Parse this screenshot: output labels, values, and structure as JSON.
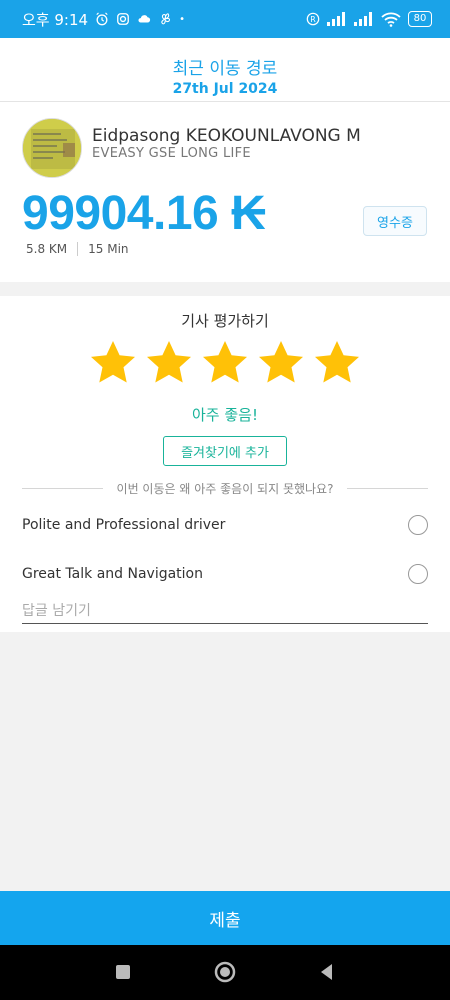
{
  "status": {
    "time": "오후 9:14",
    "battery": "80"
  },
  "header": {
    "title": "최근 이동 경로",
    "date": "27th Jul 2024"
  },
  "trip": {
    "driver_name": "Eidpasong KEOKOUNLAVONG M",
    "company": "EVEASY GSE LONG LIFE",
    "fare": "99904.16 ₭",
    "receipt_label": "영수증",
    "distance": "5.8 KM",
    "duration": "15 Min"
  },
  "rating": {
    "title": "기사 평가하기",
    "stars": 5,
    "star_color": "#ffc107",
    "result_text": "아주 좋음!",
    "favorite_label": "즐겨찾기에 추가",
    "question": "이번 이동은 왜 아주 좋음이 되지 못했나요?",
    "options": [
      "Polite and Professional driver",
      "Great Talk and Navigation"
    ],
    "comment_placeholder": "답글 남기기"
  },
  "submit_label": "제출",
  "colors": {
    "primary": "#1aa3e8",
    "accent": "#19b39a"
  }
}
